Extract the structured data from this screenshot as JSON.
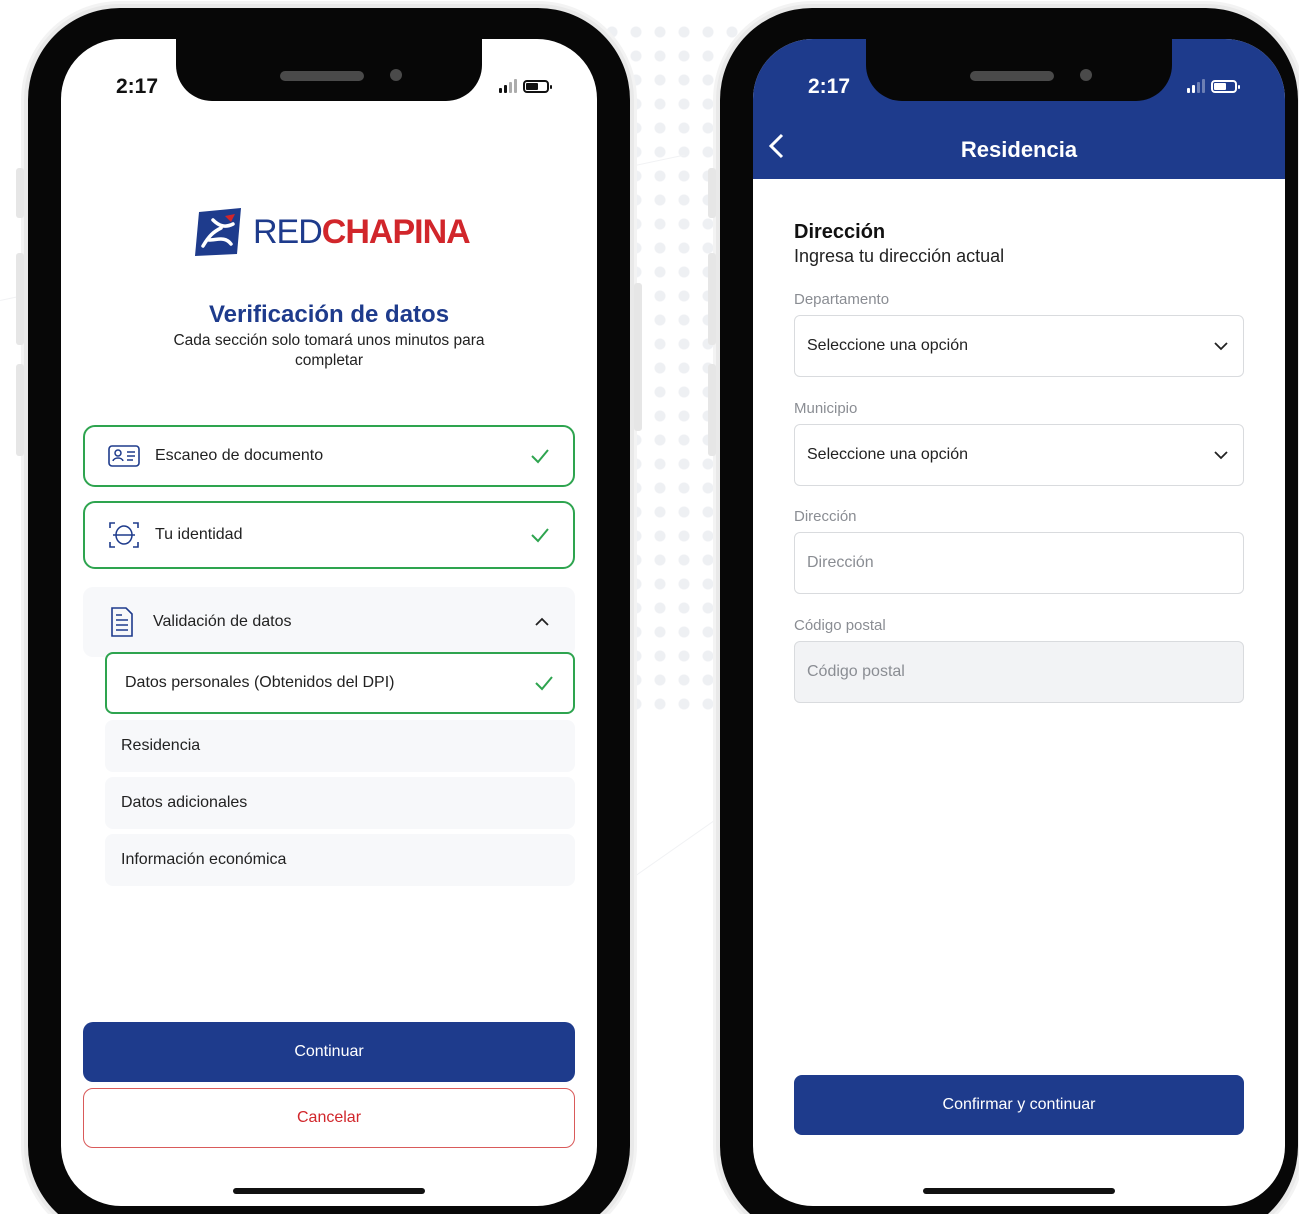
{
  "status_bar": {
    "time": "2:17"
  },
  "left_screen": {
    "brand": {
      "prefix": "RED",
      "emphasis": "CHAPINA"
    },
    "title": "Verificación de datos",
    "subtitle": "Cada sección solo tomará unos minutos para completar",
    "steps": [
      {
        "label": "Escaneo de documento",
        "icon": "id-card-icon",
        "status": "completed"
      },
      {
        "label": "Tu identidad",
        "icon": "face-scan-icon",
        "status": "completed"
      }
    ],
    "group": {
      "label": "Validación de datos",
      "icon": "document-list-icon",
      "expanded": true,
      "items": [
        {
          "label": "Datos personales (Obtenidos del DPI)",
          "status": "completed"
        },
        {
          "label": "Residencia",
          "status": "pending"
        },
        {
          "label": "Datos adicionales",
          "status": "pending"
        },
        {
          "label": "Información económica",
          "status": "pending"
        }
      ]
    },
    "buttons": {
      "continue": "Continuar",
      "cancel": "Cancelar"
    }
  },
  "right_screen": {
    "header_title": "Residencia",
    "section_title": "Dirección",
    "section_subtitle": "Ingresa tu dirección actual",
    "fields": [
      {
        "label": "Departamento",
        "value": "Seleccione una opción",
        "type": "select"
      },
      {
        "label": "Municipio",
        "value": "Seleccione una opción",
        "type": "select"
      },
      {
        "label": "Dirección",
        "placeholder": "Dirección",
        "type": "text"
      },
      {
        "label": "Código postal",
        "placeholder": "Código postal",
        "type": "text",
        "disabled": true
      }
    ],
    "confirm_button": "Confirmar y continuar"
  },
  "colors": {
    "brand_blue": "#1e3b8c",
    "brand_red": "#d1262b",
    "success_green": "#2ea44f"
  }
}
